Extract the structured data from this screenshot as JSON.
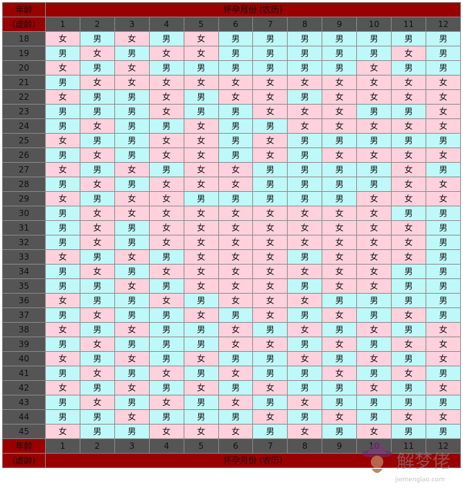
{
  "header": {
    "age_label": "年龄",
    "age_sub_label": "(虚龄)",
    "month_title": "怀孕月份 (农历)"
  },
  "months": [
    "1",
    "2",
    "3",
    "4",
    "5",
    "6",
    "7",
    "8",
    "9",
    "10",
    "11",
    "12"
  ],
  "rows": [
    {
      "age": "18",
      "cells": [
        "女",
        "男",
        "女",
        "男",
        "女",
        "男",
        "男",
        "男",
        "男",
        "男",
        "男",
        "男"
      ]
    },
    {
      "age": "19",
      "cells": [
        "男",
        "女",
        "男",
        "女",
        "女",
        "男",
        "男",
        "男",
        "男",
        "男",
        "女",
        "男"
      ]
    },
    {
      "age": "20",
      "cells": [
        "女",
        "男",
        "女",
        "男",
        "男",
        "男",
        "男",
        "男",
        "男",
        "女",
        "男",
        "男"
      ]
    },
    {
      "age": "21",
      "cells": [
        "男",
        "女",
        "女",
        "女",
        "女",
        "女",
        "女",
        "女",
        "女",
        "女",
        "女",
        "女"
      ]
    },
    {
      "age": "22",
      "cells": [
        "女",
        "男",
        "男",
        "女",
        "男",
        "女",
        "女",
        "男",
        "女",
        "女",
        "女",
        "女"
      ]
    },
    {
      "age": "23",
      "cells": [
        "男",
        "男",
        "男",
        "女",
        "男",
        "男",
        "女",
        "女",
        "女",
        "男",
        "男",
        "女"
      ]
    },
    {
      "age": "24",
      "cells": [
        "男",
        "女",
        "男",
        "男",
        "女",
        "男",
        "男",
        "女",
        "女",
        "女",
        "女",
        "女"
      ]
    },
    {
      "age": "25",
      "cells": [
        "女",
        "男",
        "男",
        "女",
        "女",
        "男",
        "女",
        "男",
        "男",
        "男",
        "男",
        "男"
      ]
    },
    {
      "age": "26",
      "cells": [
        "男",
        "女",
        "男",
        "女",
        "女",
        "男",
        "女",
        "男",
        "女",
        "女",
        "女",
        "女"
      ]
    },
    {
      "age": "27",
      "cells": [
        "女",
        "男",
        "女",
        "男",
        "女",
        "女",
        "男",
        "男",
        "男",
        "男",
        "女",
        "男"
      ]
    },
    {
      "age": "28",
      "cells": [
        "男",
        "女",
        "男",
        "女",
        "女",
        "女",
        "男",
        "男",
        "男",
        "男",
        "女",
        "女"
      ]
    },
    {
      "age": "29",
      "cells": [
        "女",
        "男",
        "女",
        "女",
        "男",
        "男",
        "男",
        "男",
        "男",
        "女",
        "女",
        "女"
      ]
    },
    {
      "age": "30",
      "cells": [
        "男",
        "女",
        "女",
        "女",
        "女",
        "女",
        "女",
        "女",
        "女",
        "女",
        "男",
        "男"
      ]
    },
    {
      "age": "31",
      "cells": [
        "男",
        "女",
        "男",
        "女",
        "女",
        "女",
        "女",
        "女",
        "女",
        "女",
        "女",
        "男"
      ]
    },
    {
      "age": "32",
      "cells": [
        "男",
        "女",
        "男",
        "女",
        "女",
        "女",
        "女",
        "女",
        "女",
        "女",
        "女",
        "男"
      ]
    },
    {
      "age": "33",
      "cells": [
        "女",
        "男",
        "女",
        "男",
        "女",
        "女",
        "女",
        "男",
        "女",
        "女",
        "女",
        "男"
      ]
    },
    {
      "age": "34",
      "cells": [
        "男",
        "女",
        "男",
        "女",
        "女",
        "女",
        "女",
        "女",
        "女",
        "女",
        "男",
        "男"
      ]
    },
    {
      "age": "35",
      "cells": [
        "男",
        "男",
        "女",
        "男",
        "女",
        "女",
        "女",
        "男",
        "女",
        "女",
        "男",
        "男"
      ]
    },
    {
      "age": "36",
      "cells": [
        "女",
        "男",
        "男",
        "女",
        "男",
        "女",
        "女",
        "女",
        "男",
        "男",
        "男",
        "男"
      ]
    },
    {
      "age": "37",
      "cells": [
        "男",
        "女",
        "男",
        "男",
        "女",
        "男",
        "女",
        "男",
        "女",
        "男",
        "女",
        "男"
      ]
    },
    {
      "age": "38",
      "cells": [
        "女",
        "男",
        "女",
        "男",
        "男",
        "女",
        "男",
        "女",
        "男",
        "女",
        "男",
        "女"
      ]
    },
    {
      "age": "39",
      "cells": [
        "男",
        "女",
        "男",
        "男",
        "男",
        "女",
        "女",
        "男",
        "女",
        "男",
        "女",
        "女"
      ]
    },
    {
      "age": "40",
      "cells": [
        "女",
        "男",
        "女",
        "男",
        "女",
        "男",
        "男",
        "女",
        "男",
        "女",
        "男",
        "女"
      ]
    },
    {
      "age": "41",
      "cells": [
        "男",
        "女",
        "男",
        "女",
        "男",
        "女",
        "男",
        "男",
        "女",
        "男",
        "女",
        "男"
      ]
    },
    {
      "age": "42",
      "cells": [
        "女",
        "男",
        "女",
        "男",
        "女",
        "男",
        "女",
        "男",
        "男",
        "女",
        "男",
        "女"
      ]
    },
    {
      "age": "43",
      "cells": [
        "男",
        "女",
        "男",
        "女",
        "男",
        "女",
        "男",
        "女",
        "男",
        "男",
        "男",
        "男"
      ]
    },
    {
      "age": "44",
      "cells": [
        "男",
        "男",
        "女",
        "男",
        "男",
        "男",
        "女",
        "男",
        "女",
        "男",
        "女",
        "女"
      ]
    },
    {
      "age": "45",
      "cells": [
        "女",
        "男",
        "男",
        "女",
        "女",
        "女",
        "男",
        "女",
        "男",
        "女",
        "男",
        "男"
      ]
    }
  ],
  "colors": {
    "boy": "#bff8f8",
    "girl": "#ffd1dc",
    "header_red": "#990000",
    "header_gray": "#555555",
    "number_green": "#b9f03a"
  },
  "watermark": {
    "text": "解梦佬",
    "site": "jiemenglao.com",
    "icon": "fortune-teller-hat-icon"
  }
}
